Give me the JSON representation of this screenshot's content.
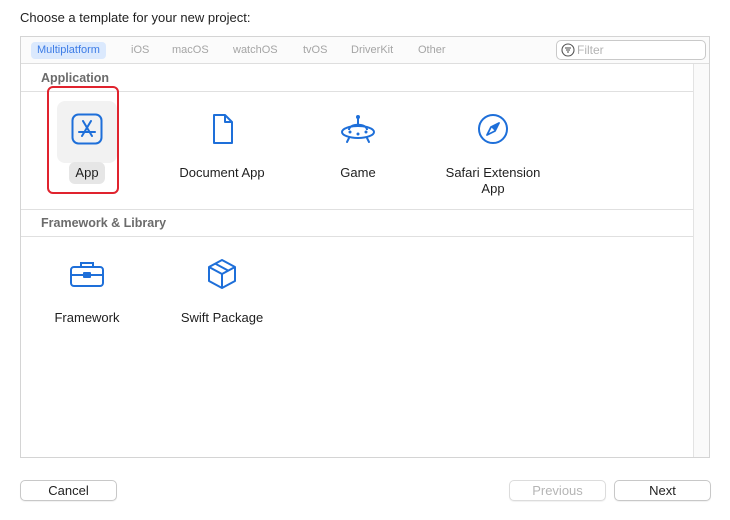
{
  "heading": "Choose a template for your new project:",
  "platform_tabs": [
    "Multiplatform",
    "iOS",
    "macOS",
    "watchOS",
    "tvOS",
    "DriverKit",
    "Other"
  ],
  "selected_tab": "Multiplatform",
  "filter": {
    "placeholder": "Filter",
    "value": ""
  },
  "sections": [
    {
      "title": "Application",
      "templates": [
        {
          "label": "App",
          "icon": "app-store-icon",
          "selected": true
        },
        {
          "label": "Document App",
          "icon": "document-icon",
          "selected": false
        },
        {
          "label": "Game",
          "icon": "game-ufo-icon",
          "selected": false
        },
        {
          "label": "Safari Extension App",
          "icon": "compass-icon",
          "selected": false
        }
      ]
    },
    {
      "title": "Framework & Library",
      "templates": [
        {
          "label": "Framework",
          "icon": "toolbox-icon",
          "selected": false
        },
        {
          "label": "Swift Package",
          "icon": "package-cube-icon",
          "selected": false
        }
      ]
    }
  ],
  "buttons": {
    "cancel": "Cancel",
    "previous": "Previous",
    "next": "Next"
  },
  "colors": {
    "accent": "#1e6fd9",
    "selected_tab_bg": "#dbe9fd",
    "highlight_border": "#e0232e"
  }
}
